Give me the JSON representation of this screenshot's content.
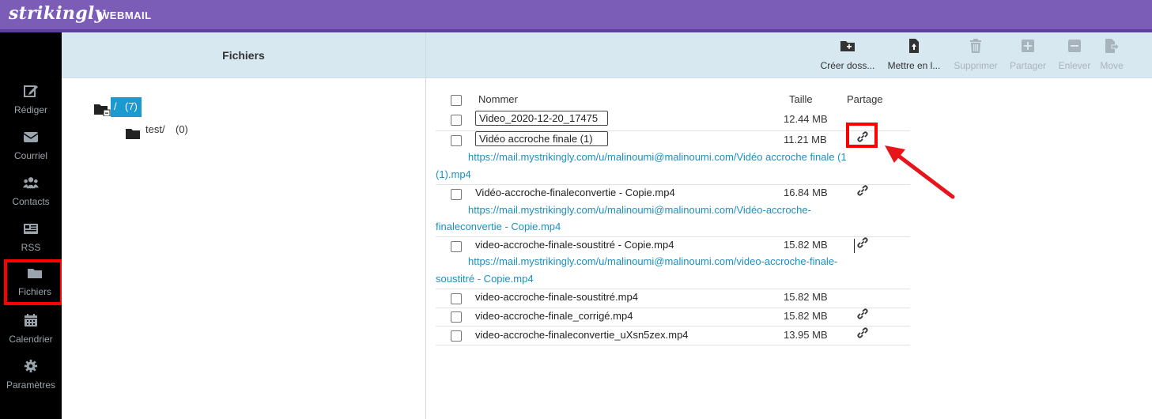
{
  "app": {
    "logo": "strikingly",
    "section": "WEBMAIL"
  },
  "sidebar": {
    "items": [
      {
        "label": "Rédiger",
        "icon": "compose-icon"
      },
      {
        "label": "Courriel",
        "icon": "envelope-icon"
      },
      {
        "label": "Contacts",
        "icon": "users-icon"
      },
      {
        "label": "RSS",
        "icon": "newspaper-icon"
      },
      {
        "label": "Fichiers",
        "icon": "folder-icon",
        "active": true
      },
      {
        "label": "Calendrier",
        "icon": "calendar-icon"
      },
      {
        "label": "Paramètres",
        "icon": "gear-icon"
      }
    ]
  },
  "folders": {
    "title": "Fichiers",
    "root": {
      "name": "/",
      "count": "(7)"
    },
    "children": [
      {
        "name": "test/",
        "count": "(0)"
      }
    ]
  },
  "toolbar": {
    "buttons": [
      {
        "label": "Créer doss...",
        "icon": "folder-plus-icon",
        "enabled": true
      },
      {
        "label": "Mettre en l...",
        "icon": "file-upload-icon",
        "enabled": true
      },
      {
        "label": "Supprimer",
        "icon": "trash-icon",
        "enabled": false
      },
      {
        "label": "Partager",
        "icon": "plus-square-icon",
        "enabled": false
      },
      {
        "label": "Enlever",
        "icon": "minus-square-icon",
        "enabled": false
      },
      {
        "label": "Move",
        "icon": "file-export-icon",
        "enabled": false
      }
    ]
  },
  "files": {
    "headers": {
      "name": "Nommer",
      "size": "Taille",
      "share": "Partage"
    },
    "rows": [
      {
        "name": "Video_2020-12-20_17475",
        "size": "12.44 MB",
        "shared": false,
        "editing": true
      },
      {
        "name": "Vidéo accroche finale (1)",
        "size": "11.21 MB",
        "shared": true,
        "editing": true,
        "url_line1": "https://mail.mystrikingly.com/u/malinoumi@malinoumi.com/Vidéo accroche finale (1",
        "url_line2": "(1).mp4"
      },
      {
        "name": "Vidéo-accroche-finaleconvertie - Copie.mp4",
        "size": "16.84 MB",
        "shared": true,
        "url_line1": "https://mail.mystrikingly.com/u/malinoumi@malinoumi.com/Vidéo-accroche-",
        "url_line2": "finaleconvertie - Copie.mp4"
      },
      {
        "name": "video-accroche-finale-soustitré - Copie.mp4",
        "size": "15.82 MB",
        "shared": true,
        "url_line1": "https://mail.mystrikingly.com/u/malinoumi@malinoumi.com/video-accroche-finale-",
        "url_line2": "soustitré - Copie.mp4"
      },
      {
        "name": "video-accroche-finale-soustitré.mp4",
        "size": "15.82 MB",
        "shared": false
      },
      {
        "name": "video-accroche-finale_corrigé.mp4",
        "size": "15.82 MB",
        "shared": true
      },
      {
        "name": "video-accroche-finaleconvertie_uXsn5zex.mp4",
        "size": "13.95 MB",
        "shared": true
      }
    ]
  },
  "colors": {
    "topbar": "#7b5db8",
    "sidebar": "#000000",
    "header_bg": "#d7e8f1",
    "link": "#1d8fc0",
    "selection": "#1b9ad1",
    "annotation": "#ff0000"
  }
}
